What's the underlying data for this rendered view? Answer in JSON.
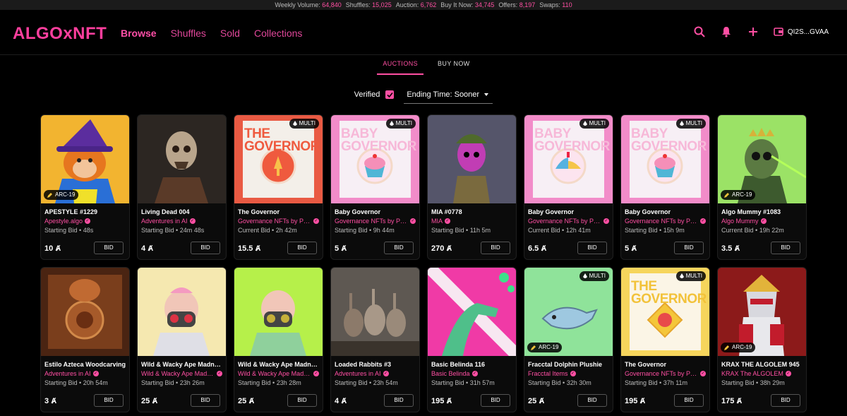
{
  "stats": [
    {
      "label": "Weekly Volume:",
      "value": "64,840"
    },
    {
      "label": "Shuffles:",
      "value": "15,025"
    },
    {
      "label": "Auction:",
      "value": "6,762"
    },
    {
      "label": "Buy It Now:",
      "value": "34,745"
    },
    {
      "label": "Offers:",
      "value": "8,197"
    },
    {
      "label": "Swaps:",
      "value": "110"
    }
  ],
  "logo": "ALGOxNFT",
  "nav": [
    "Browse",
    "Shuffles",
    "Sold",
    "Collections"
  ],
  "nav_active": "Browse",
  "wallet": "QI2S...GVAA",
  "icons": [
    "search-icon",
    "bell-icon",
    "plus-icon",
    "wallet-icon"
  ],
  "tabs": [
    "AUCTIONS",
    "BUY NOW"
  ],
  "tab_active": "AUCTIONS",
  "filters": {
    "verified": "Verified",
    "verified_checked": true,
    "sort": "Ending Time: Sooner"
  },
  "bid_label": "BID",
  "currency_symbol": "Ⱥ",
  "colors": {
    "accent": "#ff4fa3",
    "background": "#000000"
  },
  "cards": [
    {
      "name": "APESTYLE #1229",
      "collection": "Apestyle.algo",
      "bid_type": "Starting Bid",
      "time": "48s",
      "price": "10",
      "badge": "ARC-19",
      "thumb": "ape-orange"
    },
    {
      "name": "Living Dead 004",
      "collection": "Adventures in AI",
      "bid_type": "Starting Bid",
      "time": "24m 48s",
      "price": "4",
      "badge": "",
      "thumb": "skeleton"
    },
    {
      "name": "The Governor",
      "collection": "Governance NFTs by Pera",
      "bid_type": "Current Bid",
      "time": "2h 42m",
      "price": "15.5",
      "badge": "MULTI",
      "thumb": "governor-red",
      "art_title": "THE GOVERNOR"
    },
    {
      "name": "Baby Governor",
      "collection": "Governance NFTs by Pera",
      "bid_type": "Starting Bid",
      "time": "9h 44m",
      "price": "5",
      "badge": "MULTI",
      "thumb": "baby-cupcake",
      "art_title": "BABY GOVERNOR"
    },
    {
      "name": "MIA #0778",
      "collection": "MIA",
      "bid_type": "Starting Bid",
      "time": "11h 5m",
      "price": "270",
      "badge": "",
      "thumb": "mia-soldier"
    },
    {
      "name": "Baby Governor",
      "collection": "Governance NFTs by Pera",
      "bid_type": "Current Bid",
      "time": "12h 41m",
      "price": "6.5",
      "badge": "MULTI",
      "thumb": "baby-hat",
      "art_title": "BABY GOVERNOR"
    },
    {
      "name": "Baby Governor",
      "collection": "Governance NFTs by Pera",
      "bid_type": "Starting Bid",
      "time": "15h 9m",
      "price": "5",
      "badge": "MULTI",
      "thumb": "baby-cupcake",
      "art_title": "BABY GOVERNOR"
    },
    {
      "name": "Algo Mummy #1083",
      "collection": "Algo Mummy",
      "bid_type": "Current Bid",
      "time": "19h 22m",
      "price": "3.5",
      "badge": "ARC-19",
      "thumb": "mummy-green"
    },
    {
      "name": "Estilo Azteca Woodcarving",
      "collection": "Adventures in AI",
      "bid_type": "Starting Bid",
      "time": "20h 54m",
      "price": "3",
      "badge": "",
      "thumb": "aztec"
    },
    {
      "name": "Wild & Wacky Ape Madness",
      "collection": "Wild & Wacky Ape Madness",
      "bid_type": "Starting Bid",
      "time": "23h 26m",
      "price": "25",
      "badge": "",
      "thumb": "ape-mask-light"
    },
    {
      "name": "Wild & Wacky Ape Madness",
      "collection": "Wild & Wacky Ape Madness",
      "bid_type": "Starting Bid",
      "time": "23h 28m",
      "price": "25",
      "badge": "",
      "thumb": "ape-mask-green"
    },
    {
      "name": "Loaded Rabbits #3",
      "collection": "Adventures in AI",
      "bid_type": "Starting Bid",
      "time": "23h 54m",
      "price": "4",
      "badge": "",
      "thumb": "rabbits"
    },
    {
      "name": "Basic Belinda 116",
      "collection": "Basic Belinda",
      "bid_type": "Starting Bid",
      "time": "31h 57m",
      "price": "195",
      "badge": "",
      "thumb": "belinda"
    },
    {
      "name": "Fracctal Dolphin Plushie",
      "collection": "Fracctal Items",
      "bid_type": "Starting Bid",
      "time": "32h 30m",
      "price": "25",
      "badge": "MULTI",
      "badge2": "ARC-19",
      "thumb": "dolphin"
    },
    {
      "name": "The Governor",
      "collection": "Governance NFTs by Pera",
      "bid_type": "Starting Bid",
      "time": "37h 11m",
      "price": "195",
      "badge": "MULTI",
      "thumb": "governor-yellow",
      "art_title": "THE GOVERNOR"
    },
    {
      "name": "KRAX THE ALGOLEM 945",
      "collection": "KRAX The ALGOLEM",
      "bid_type": "Starting Bid",
      "time": "38h 29m",
      "price": "175",
      "badge": "ARC-19",
      "thumb": "krax"
    }
  ]
}
